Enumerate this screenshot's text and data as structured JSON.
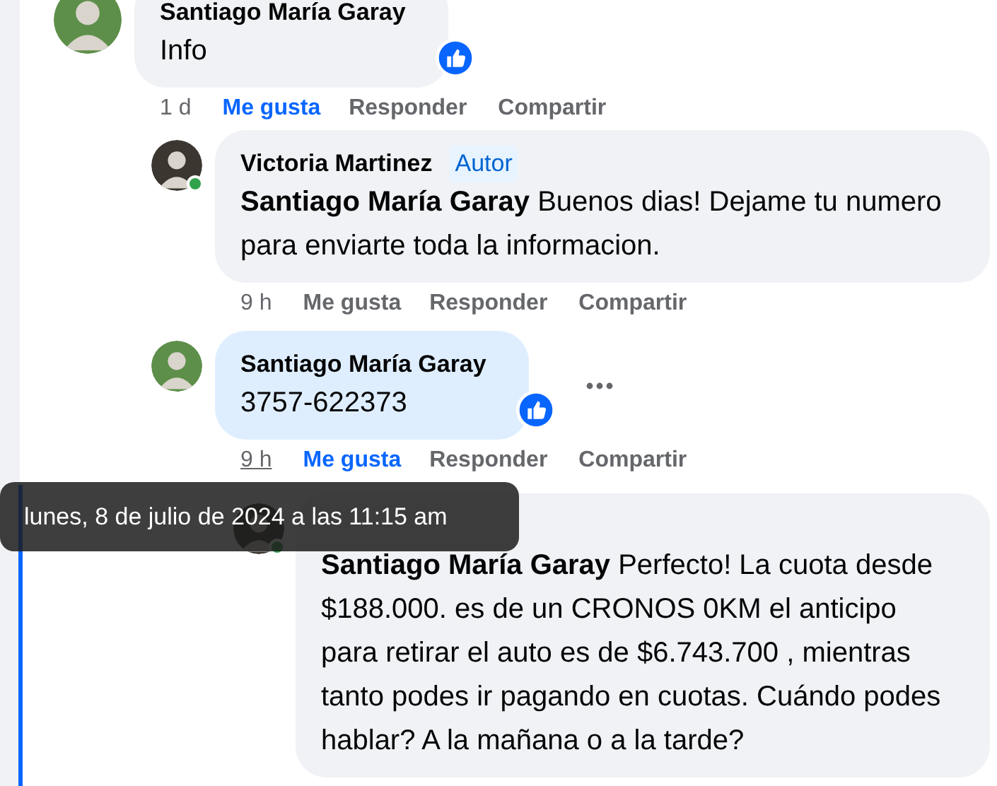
{
  "comments": [
    {
      "author": "Santiago María Garay",
      "avatar": {
        "color": "#5e8f4a"
      },
      "online": false,
      "highlighted": false,
      "text": "Info",
      "like_reaction": true,
      "time": "1 d",
      "time_underlined": false,
      "liked": true,
      "actions": [
        {
          "kind": "like",
          "label": "Me gusta"
        },
        {
          "kind": "reply",
          "label": "Responder"
        },
        {
          "kind": "share",
          "label": "Compartir"
        }
      ],
      "children": [
        {
          "author": "Victoria Martinez",
          "badge": "Autor",
          "avatar": {
            "color": "#3b3630"
          },
          "online": true,
          "highlighted": false,
          "text": "**Santiago María Garay** Buenos dias! Dejame tu numero para enviarte toda la informacion.",
          "time": "9 h",
          "time_underlined": false,
          "liked": false,
          "actions": [
            {
              "kind": "like",
              "label": "Me gusta"
            },
            {
              "kind": "reply",
              "label": "Responder"
            },
            {
              "kind": "share",
              "label": "Compartir"
            }
          ]
        },
        {
          "author": "Santiago María Garay",
          "avatar": {
            "color": "#5e8f4a"
          },
          "online": false,
          "highlighted": true,
          "text": "3757-622373",
          "like_reaction": true,
          "time": "9 h",
          "time_underlined": true,
          "liked": true,
          "actions": [
            {
              "kind": "like",
              "label": "Me gusta"
            },
            {
              "kind": "reply",
              "label": "Responder"
            },
            {
              "kind": "share",
              "label": "Compartir"
            }
          ],
          "children": [
            {
              "avatar": {
                "color": "#3b3630"
              },
              "online": true,
              "highlighted": false,
              "text": "**Santiago María Garay** Perfecto! La cuota desde $188.000. es de un CRONOS 0KM el anticipo para retirar el auto es de $6.743.700 , mientras tanto podes ir pagando en cuotas. Cuándo podes hablar? A la mañana o a la tarde?"
            }
          ]
        }
      ]
    }
  ],
  "tooltip": {
    "text": "lunes, 8 de julio de 2024 a las 11:15 am"
  }
}
